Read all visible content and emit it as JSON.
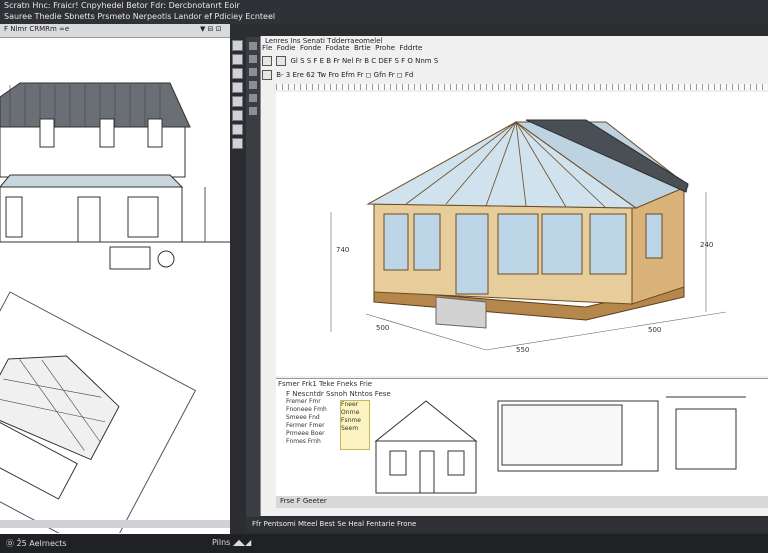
{
  "app": {
    "menu_line1": "Scratn Hnc: Fraicr! Cnpyhedel Betor Fdr: Dercbnotanrt Eoir",
    "menu_line2": "Sauree Thedie Sbnetts Prsmeto Nerpeotis Landor ef Pdiciey Ecnteel"
  },
  "left_pane": {
    "toolbar_left": "F Nlmr CRMRm  ∞e",
    "toolbar_right": "▼ ⊟ ⊡"
  },
  "right_window": {
    "title": "Lenres Ins Senati Tdderraeomelel",
    "menu": [
      "Fle",
      "Fodie",
      "Fonde",
      "Fodate",
      "Brtie",
      "Prohe",
      "Fddrte"
    ],
    "toolbar1": "Gl S S F E B  Fr Nel Fr  B C DEF S  F O Nnm  S",
    "toolbar2": "B- 3 Ere 62  Tw  Fro Efm Fr  ◻ Gfn  Fr  ◻ Fd",
    "dims": {
      "left_height": "740",
      "right_height": "240",
      "front_a": "500",
      "front_b": "550",
      "side": "500"
    },
    "lower_header": "Fsmer Frk1 Teke Fneks Frie",
    "lower_tabs": "F Nescntdr Ssnoh Ntntos  Fese",
    "tree_items": [
      "Fremer Fmr",
      "Fnoneee Fmh",
      "Smeee Fnd",
      "Fermer Fmer",
      "Prmeee Boer",
      "Fnmes Frnh"
    ],
    "yellow_items": [
      "Fneer",
      "Onrne",
      "Fsnme",
      "Seem"
    ],
    "status": "Frse  F Geeter",
    "bottom_status": "Ffr  Pentsomi Mteel Best  Se Heal Fentarie Frone"
  },
  "taskbar": {
    "left": "Ⓓ  2̃5 Aelrnects",
    "right": "Pilns  ◢◣◢"
  }
}
